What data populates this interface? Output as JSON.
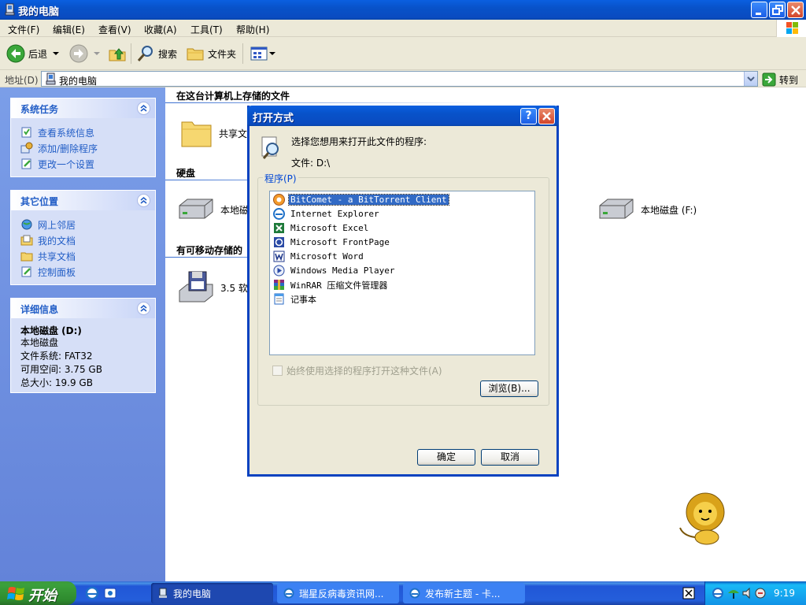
{
  "window": {
    "title": "我的电脑",
    "menu": [
      "文件(F)",
      "编辑(E)",
      "查看(V)",
      "收藏(A)",
      "工具(T)",
      "帮助(H)"
    ],
    "toolbar": {
      "back": "后退",
      "search": "搜索",
      "folders": "文件夹"
    },
    "address": {
      "label": "地址(D)",
      "value": "我的电脑",
      "goto": "转到"
    }
  },
  "sidebar": {
    "system_tasks": {
      "title": "系统任务",
      "items": [
        "查看系统信息",
        "添加/删除程序",
        "更改一个设置"
      ]
    },
    "other_places": {
      "title": "其它位置",
      "items": [
        "网上邻居",
        "我的文档",
        "共享文档",
        "控制面板"
      ]
    },
    "details": {
      "title": "详细信息",
      "name": "本地磁盘 (D:)",
      "type": "本地磁盘",
      "fs": "文件系统: FAT32",
      "free": "可用空间: 3.75 GB",
      "total": "总大小: 19.9 GB"
    }
  },
  "content": {
    "section_files": "在这台计算机上存储的文件",
    "shared_docs": "共享文",
    "section_disks": "硬盘",
    "disk_left": "本地磁",
    "disk_f": "本地磁盘 (F:)",
    "section_removable": "有可移动存储的",
    "floppy": "3.5 软"
  },
  "dialog": {
    "title": "打开方式",
    "help": "?",
    "prompt": "选择您想用来打开此文件的程序:",
    "file": "文件: D:\\",
    "group_label": "程序(P)",
    "programs": [
      "BitComet - a BitTorrent Client",
      "Internet Explorer",
      "Microsoft Excel",
      "Microsoft FrontPage",
      "Microsoft Word",
      "Windows Media Player",
      "WinRAR 压缩文件管理器",
      "记事本"
    ],
    "always_use": "始终使用选择的程序打开这种文件(A)",
    "browse": "浏览(B)...",
    "ok": "确定",
    "cancel": "取消"
  },
  "taskbar": {
    "start": "开始",
    "tasks": [
      "我的电脑",
      "瑞星反病毒资讯网...",
      "发布新主题 - 卡..."
    ],
    "clock": "9:19"
  }
}
